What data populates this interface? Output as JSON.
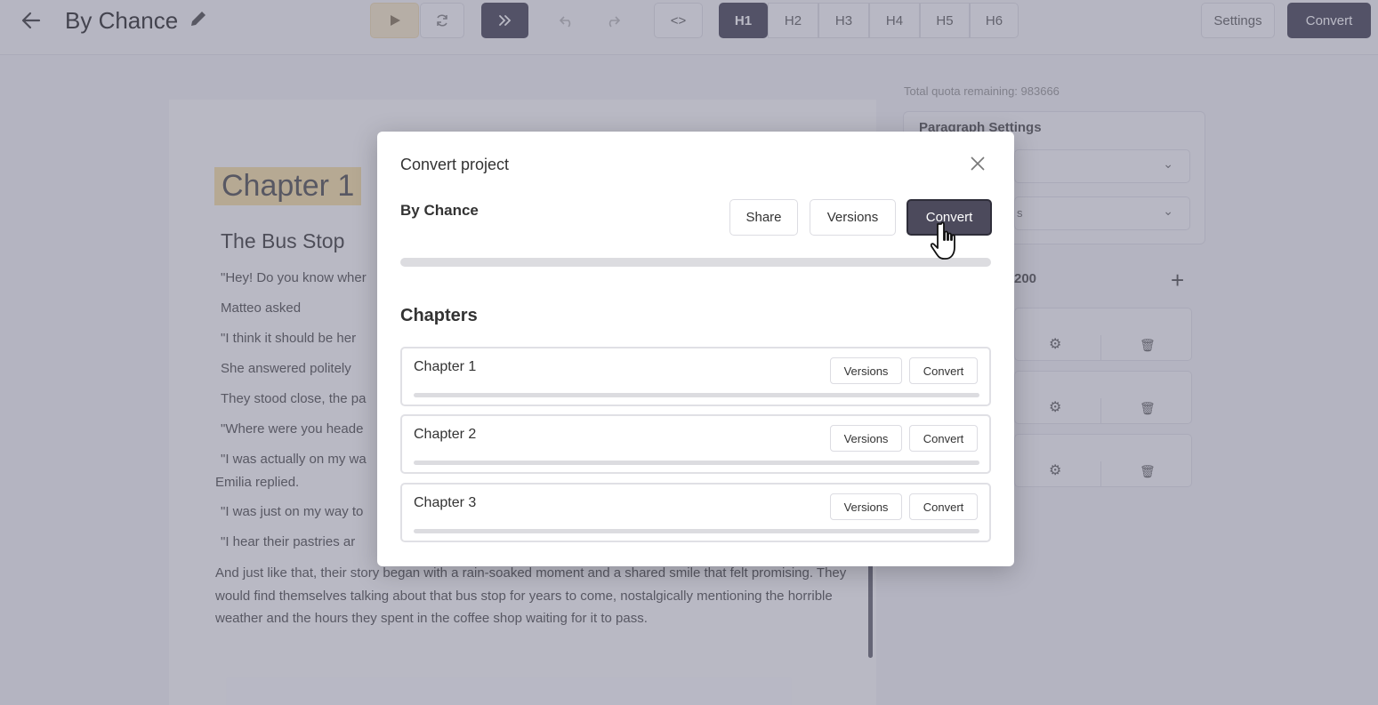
{
  "header": {
    "back_icon": "arrow-left-icon",
    "title": "By Chance",
    "edit_icon": "pencil-icon",
    "toolbar": {
      "play_icon": "play-icon",
      "refresh_icon": "refresh-icon",
      "fast_forward_icon": "fast-forward-icon",
      "undo_icon": "undo-icon",
      "redo_icon": "redo-icon",
      "code_label": "<>",
      "headings": [
        "H1",
        "H2",
        "H3",
        "H4",
        "H5",
        "H6"
      ],
      "active_heading": "H1"
    },
    "settings_label": "Settings",
    "convert_label": "Convert"
  },
  "editor": {
    "chapter_title": "Chapter 1",
    "subtitle": "The Bus Stop",
    "paragraphs": [
      "\"Hey! Do you know wher",
      "Matteo asked",
      "\"I think it should be her",
      "She answered politely",
      "They stood close, the pa",
      "\"Where were you heade",
      "\"I was actually on my wa",
      "Emilia replied.",
      "\"I was just on my way to",
      "\"I hear their pastries ar"
    ],
    "last_paragraph": "And just like that, their story began with a rain-soaked moment and a shared smile that felt promising. They would find themselves talking about that bus stop for years to come, nostalgically mentioning the horrible weather and the hours they spent in the coffee shop waiting for it to pass."
  },
  "settings_panel": {
    "quota": "Total quota remaining: 983666",
    "title": "Paragraph Settings",
    "select2_value": "s",
    "number": "200"
  },
  "modal": {
    "title": "Convert project",
    "project_name": "By Chance",
    "share_label": "Share",
    "versions_label": "Versions",
    "convert_label": "Convert",
    "chapters_heading": "Chapters",
    "chapters": [
      {
        "name": "Chapter 1",
        "versions_label": "Versions",
        "convert_label": "Convert"
      },
      {
        "name": "Chapter 2",
        "versions_label": "Versions",
        "convert_label": "Convert"
      },
      {
        "name": "Chapter 3",
        "versions_label": "Versions",
        "convert_label": "Convert"
      }
    ]
  },
  "colors": {
    "accent_dark": "#4c4a5c",
    "highlight": "#f7e1a8",
    "overlay": "#5c5c78"
  }
}
